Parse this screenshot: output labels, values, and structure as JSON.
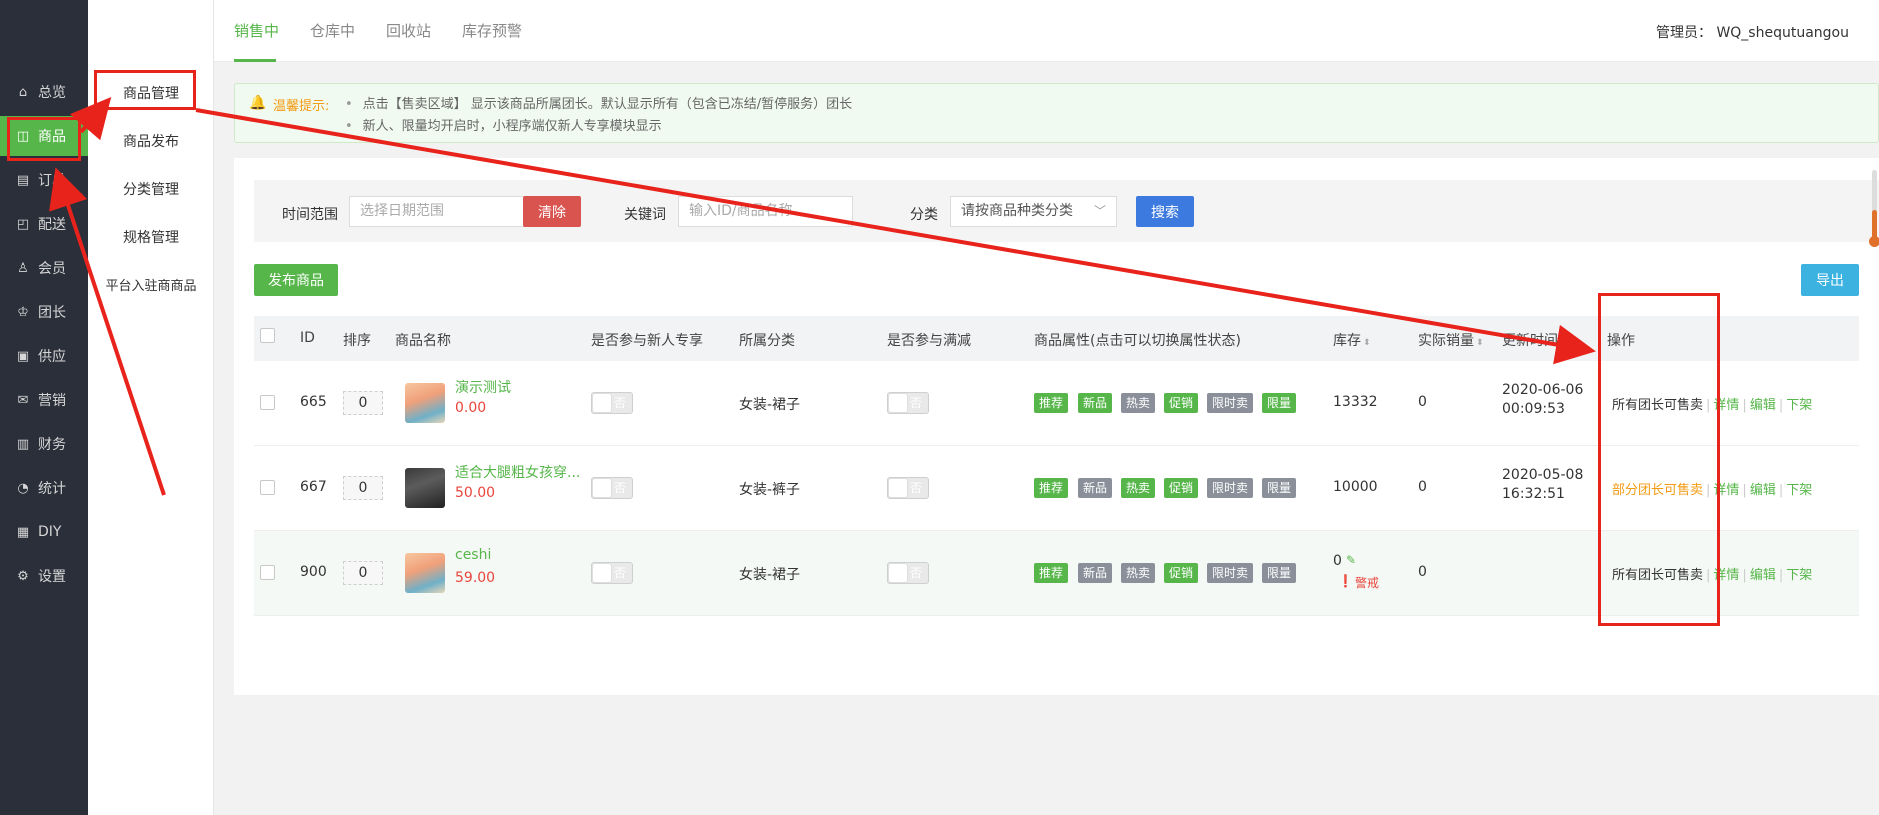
{
  "sidebar": {
    "items": [
      {
        "label": "总览",
        "icon": "home-icon",
        "glyph": "⌂"
      },
      {
        "label": "商品",
        "icon": "shop-bag-icon",
        "glyph": "◫"
      },
      {
        "label": "订单",
        "icon": "cart-icon",
        "glyph": "▤"
      },
      {
        "label": "配送",
        "icon": "delivery-icon",
        "glyph": "◰"
      },
      {
        "label": "会员",
        "icon": "user-icon",
        "glyph": "♙"
      },
      {
        "label": "团长",
        "icon": "leader-icon",
        "glyph": "♔"
      },
      {
        "label": "供应",
        "icon": "supply-icon",
        "glyph": "▣"
      },
      {
        "label": "营销",
        "icon": "gift-icon",
        "glyph": "✉"
      },
      {
        "label": "财务",
        "icon": "finance-icon",
        "glyph": "▥"
      },
      {
        "label": "统计",
        "icon": "stats-icon",
        "glyph": "◔"
      },
      {
        "label": "DIY",
        "icon": "layout-icon",
        "glyph": "▦"
      },
      {
        "label": "设置",
        "icon": "gear-icon",
        "glyph": "⚙"
      }
    ]
  },
  "subnav": {
    "items": [
      "商品管理",
      "商品发布",
      "分类管理",
      "规格管理",
      "平台入驻商商品"
    ]
  },
  "tabs": [
    "销售中",
    "仓库中",
    "回收站",
    "库存预警"
  ],
  "admin": "管理员： WQ_shequtuangou",
  "tip": {
    "title": "温馨提示:",
    "lines": [
      "点击【售卖区域】 显示该商品所属团长。默认显示所有（包含已冻结/暂停服务）团长",
      "新人、限量均开启时，小程序端仅新人专享模块显示"
    ]
  },
  "filter": {
    "time_label": "时间范围",
    "time_placeholder": "选择日期范围",
    "clear_label": "清除",
    "keyword_label": "关键词",
    "keyword_placeholder": "输入ID/商品名称",
    "category_label": "分类",
    "category_placeholder": "请按商品种类分类",
    "search_label": "搜索"
  },
  "actions": {
    "publish_label": "发布商品",
    "export_label": "导出"
  },
  "table": {
    "headers": {
      "id": "ID",
      "sort": "排序",
      "name": "商品名称",
      "newuser": "是否参与新人专享",
      "category": "所属分类",
      "discount": "是否参与满减",
      "attrs": "商品属性(点击可以切换属性状态)",
      "stock": "库存",
      "sales": "实际销量",
      "time": "更新时间",
      "ops": "操作"
    },
    "switch_off": "否",
    "tag_labels": [
      "推荐",
      "新品",
      "热卖",
      "促销",
      "限时卖",
      "限量"
    ],
    "op_detail": "详情",
    "op_edit": "编辑",
    "op_down": "下架",
    "rows": [
      {
        "id": "665",
        "sort": "0",
        "name": "演示测试",
        "price": "0.00",
        "category": "女装-裙子",
        "stock": "13332",
        "sales": "0",
        "date": "2020-06-06",
        "time": "00:09:53",
        "sale_scope": "所有团长可售卖",
        "scope_color": "#333333",
        "tags_on": [
          true,
          true,
          false,
          true,
          false,
          true
        ],
        "thumb": "warm"
      },
      {
        "id": "667",
        "sort": "0",
        "name": "适合大腿粗女孩穿...",
        "price": "50.00",
        "category": "女装-裤子",
        "stock": "10000",
        "sales": "0",
        "date": "2020-05-08",
        "time": "16:32:51",
        "sale_scope": "部分团长可售卖",
        "scope_color": "#f39b12",
        "tags_on": [
          true,
          false,
          true,
          true,
          false,
          false
        ],
        "thumb": "dark"
      },
      {
        "id": "900",
        "sort": "0",
        "name": "ceshi",
        "price": "59.00",
        "category": "女装-裙子",
        "stock": "0",
        "stock_warn": "警戒",
        "sales": "0",
        "date": "",
        "time": "",
        "sale_scope": "所有团长可售卖",
        "scope_color": "#333333",
        "tags_on": [
          true,
          false,
          false,
          true,
          false,
          false
        ],
        "thumb": "warm"
      }
    ]
  },
  "colors": {
    "accent": "#56b64a",
    "sidebar_bg": "#2b2f3a",
    "danger": "#d9534f",
    "primary": "#3d7ae0",
    "info": "#3bb2e0",
    "tag_off": "#8a8f99",
    "annotation": "#e8231b"
  }
}
